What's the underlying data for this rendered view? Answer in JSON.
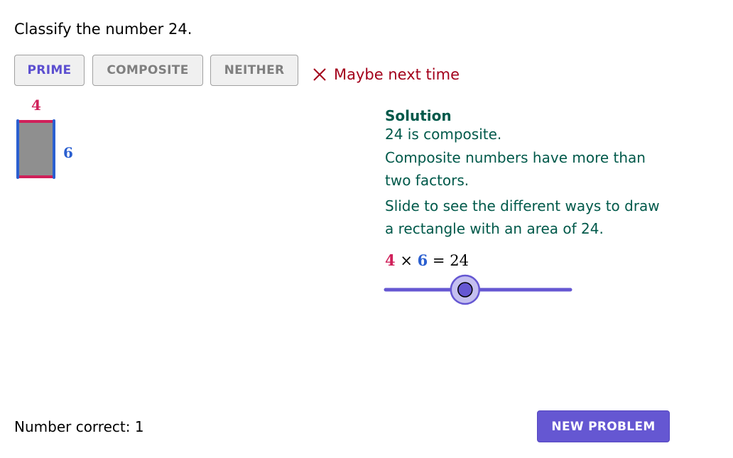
{
  "question": {
    "prompt": "Classify the number 24."
  },
  "choices": [
    {
      "label": "PRIME",
      "selected": true
    },
    {
      "label": "COMPOSITE",
      "selected": false
    },
    {
      "label": "NEITHER",
      "selected": false
    }
  ],
  "feedback": {
    "icon": "x-icon",
    "text": "Maybe next time",
    "color": "#a3001b"
  },
  "rectangle": {
    "width_label": "4",
    "height_label": "6",
    "width_color": "#d0205a",
    "height_color": "#2a5fd0"
  },
  "solution": {
    "title": "Solution",
    "line1": "24 is composite.",
    "line2": "Composite numbers have more than two factors.",
    "line3": "Slide to see the different ways to draw a rectangle with an area of 24."
  },
  "equation": {
    "factor_a": "4",
    "times": "×",
    "factor_b": "6",
    "equals": "=",
    "product": "24"
  },
  "slider": {
    "position_fraction": 0.43
  },
  "score": {
    "text": "Number correct: 1"
  },
  "actions": {
    "new_problem_label": "NEW PROBLEM"
  },
  "colors": {
    "accent": "#6557d2",
    "solution_text": "#00594a"
  }
}
